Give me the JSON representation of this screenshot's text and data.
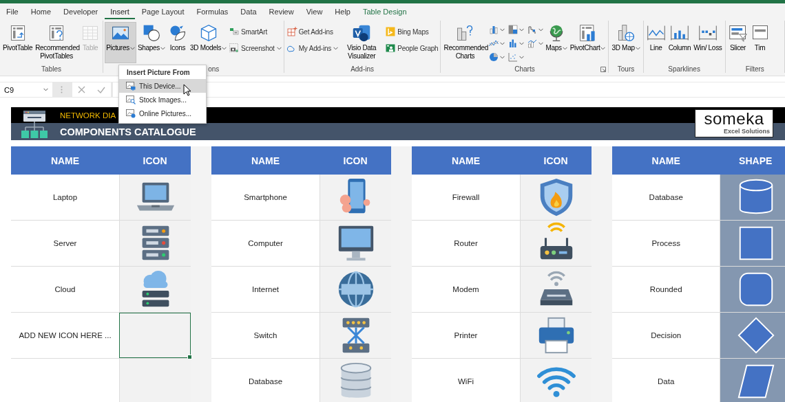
{
  "tabs": [
    {
      "label": "File",
      "selected": false,
      "contextual": false
    },
    {
      "label": "Home",
      "selected": false,
      "contextual": false
    },
    {
      "label": "Developer",
      "selected": false,
      "contextual": false
    },
    {
      "label": "Insert",
      "selected": true,
      "contextual": false
    },
    {
      "label": "Page Layout",
      "selected": false,
      "contextual": false
    },
    {
      "label": "Formulas",
      "selected": false,
      "contextual": false
    },
    {
      "label": "Data",
      "selected": false,
      "contextual": false
    },
    {
      "label": "Review",
      "selected": false,
      "contextual": false
    },
    {
      "label": "View",
      "selected": false,
      "contextual": false
    },
    {
      "label": "Help",
      "selected": false,
      "contextual": false
    },
    {
      "label": "Table Design",
      "selected": false,
      "contextual": true
    }
  ],
  "ribbon": [
    {
      "label": "Tables",
      "launcher": false,
      "columns": [
        {
          "kind": "pivot-table",
          "label": "PivotTable",
          "dropdown": false,
          "pressed": false,
          "disabled": false
        },
        {
          "kind": "pivot-question",
          "label": "Recommended PivotTables",
          "dropdown": false,
          "pressed": false,
          "disabled": false
        },
        {
          "kind": "grid-table",
          "label": "Table",
          "dropdown": false,
          "pressed": false,
          "disabled": true
        }
      ]
    },
    {
      "label": "ons",
      "launcher": false,
      "columns": [
        {
          "kind": "landscape",
          "label": "Pictures",
          "dropdown": true,
          "pressed": true,
          "disabled": false
        },
        {
          "kind": "shapes",
          "label": "Shapes",
          "dropdown": true,
          "pressed": false,
          "disabled": false
        },
        {
          "kind": "bird-leaf",
          "label": "Icons",
          "dropdown": false,
          "pressed": false,
          "disabled": false
        },
        {
          "kind": "cube",
          "label": "3D Models",
          "dropdown": true,
          "pressed": false,
          "disabled": false
        },
        {
          "stack": [
            {
              "kind": "smartart",
              "label": "SmartArt",
              "dropdown": false
            },
            {
              "kind": "screenshot",
              "label": "Screenshot",
              "dropdown": true
            }
          ]
        }
      ]
    },
    {
      "label": "Add-ins",
      "launcher": false,
      "columns": [
        {
          "stack": [
            {
              "kind": "store",
              "label": "Get Add-ins",
              "dropdown": false
            },
            {
              "kind": "ring",
              "label": "My Add-ins",
              "dropdown": true
            }
          ]
        },
        {
          "kind": "app-tile",
          "label": "Visio Data Visualizer",
          "dropdown": false,
          "pressed": false,
          "disabled": false
        },
        {
          "stack": [
            {
              "kind": "tile-logo",
              "label": "Bing Maps",
              "dropdown": false
            },
            {
              "kind": "people-card",
              "label": "People Graph",
              "dropdown": false
            }
          ]
        }
      ]
    },
    {
      "label": "Charts",
      "launcher": true,
      "columns": [
        {
          "kind": "chart-question",
          "label": "Recommended Charts",
          "dropdown": false,
          "pressed": false,
          "disabled": false
        },
        {
          "grid": [
            {
              "kind": "column-chart",
              "dropdown": true
            },
            {
              "kind": "hierarchy-chart",
              "dropdown": true
            },
            {
              "kind": "waterfall-chart",
              "dropdown": true
            },
            {
              "kind": "line-chart",
              "dropdown": true
            },
            {
              "kind": "bar-chart",
              "dropdown": true
            },
            {
              "kind": "combo-chart",
              "dropdown": true
            },
            {
              "kind": "pie-chart",
              "dropdown": true
            },
            {
              "kind": "scatter-chart",
              "dropdown": true
            }
          ]
        },
        {
          "kind": "globe",
          "label": "Maps",
          "dropdown": true,
          "pressed": false,
          "disabled": false
        },
        {
          "kind": "pivot-chart",
          "label": "PivotChart",
          "dropdown": true,
          "pressed": false,
          "disabled": false
        }
      ]
    },
    {
      "label": "Tours",
      "launcher": false,
      "columns": [
        {
          "kind": "map-3d",
          "label": "3D Map",
          "dropdown": true,
          "pressed": false,
          "disabled": false
        }
      ]
    },
    {
      "label": "Sparklines",
      "launcher": false,
      "columns": [
        {
          "kind": "sparkline-line",
          "label": "Line",
          "dropdown": false,
          "pressed": false,
          "disabled": false
        },
        {
          "kind": "sparkline-column",
          "label": "Column",
          "dropdown": false,
          "pressed": false,
          "disabled": false
        },
        {
          "kind": "sparkline-winloss",
          "label": "Win/ Loss",
          "dropdown": false,
          "pressed": false,
          "disabled": false
        }
      ]
    },
    {
      "label": "Filters",
      "launcher": false,
      "columns": [
        {
          "kind": "slicer",
          "label": "Slicer",
          "dropdown": false,
          "pressed": false,
          "disabled": false
        },
        {
          "kind": "timeline",
          "label": "Tim",
          "dropdown": false,
          "pressed": false,
          "disabled": false
        }
      ]
    }
  ],
  "name_box": "C9",
  "picture_menu": {
    "title": "Insert Picture From",
    "items": [
      {
        "label": "This Device...",
        "selected": true
      },
      {
        "label": "Stock Images...",
        "selected": false
      },
      {
        "label": "Online Pictures...",
        "selected": false
      }
    ]
  },
  "banner": {
    "title": "NETWORK DIA",
    "subtitle": "COMPONENTS CATALOGUE",
    "logo": "someka",
    "logo_tagline": "Excel Solutions"
  },
  "tables": [
    {
      "columns": [
        "NAME",
        "ICON"
      ],
      "rows": [
        {
          "name": "Laptop",
          "kind": "laptop",
          "selected": false
        },
        {
          "name": "Server",
          "kind": "server",
          "selected": false
        },
        {
          "name": "Cloud",
          "kind": "cloud-server",
          "selected": false
        },
        {
          "name": "ADD NEW ICON HERE ...",
          "kind": "empty",
          "selected": true
        }
      ]
    },
    {
      "columns": [
        "NAME",
        "ICON"
      ],
      "rows": [
        {
          "name": "Smartphone",
          "kind": "phone-in-hand",
          "selected": false
        },
        {
          "name": "Computer",
          "kind": "monitor",
          "selected": false
        },
        {
          "name": "Internet",
          "kind": "web-globe",
          "selected": false
        },
        {
          "name": "Switch",
          "kind": "network-switch",
          "selected": false
        },
        {
          "name": "Database",
          "kind": "database",
          "selected": false
        }
      ]
    },
    {
      "columns": [
        "NAME",
        "ICON"
      ],
      "rows": [
        {
          "name": "Firewall",
          "kind": "shield-flame",
          "selected": false
        },
        {
          "name": "Router",
          "kind": "router",
          "selected": false
        },
        {
          "name": "Modem",
          "kind": "modem",
          "selected": false
        },
        {
          "name": "Printer",
          "kind": "printer",
          "selected": false
        },
        {
          "name": "WiFi",
          "kind": "wifi",
          "selected": false
        }
      ]
    },
    {
      "columns": [
        "NAME",
        "SHAPE"
      ],
      "rows": [
        {
          "name": "Database",
          "kind": "cylinder",
          "selected": false
        },
        {
          "name": "Process",
          "kind": "square",
          "selected": false
        },
        {
          "name": "Rounded",
          "kind": "rounded-square",
          "selected": false
        },
        {
          "name": "Decision",
          "kind": "diamond",
          "selected": false
        },
        {
          "name": "Data",
          "kind": "parallelogram",
          "selected": false
        }
      ]
    }
  ]
}
